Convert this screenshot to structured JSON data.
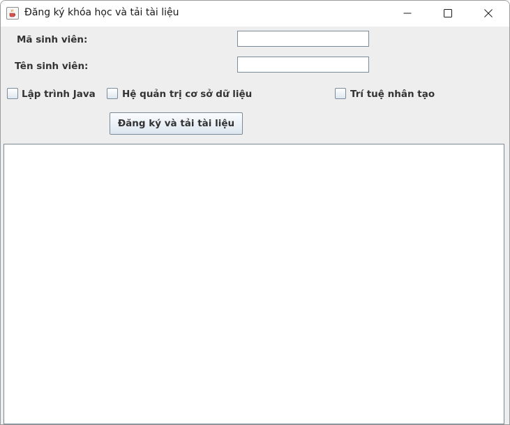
{
  "window": {
    "title": "Đăng ký khóa học và tải tài liệu",
    "icon": "java-cup-icon"
  },
  "form": {
    "student_id_label": "Mã sinh viên:",
    "student_id_value": "",
    "student_name_label": "Tên sinh viên:",
    "student_name_value": ""
  },
  "courses": [
    {
      "label": "Lập trình Java",
      "checked": false
    },
    {
      "label": "Hệ quản trị cơ sở dữ liệu",
      "checked": false
    },
    {
      "label": "Trí tuệ nhân tạo",
      "checked": false
    }
  ],
  "actions": {
    "submit_label": "Đăng ký và tải tài liệu"
  },
  "output": {
    "text": ""
  },
  "colors": {
    "window_bg": "#eeeeee",
    "titlebar_bg": "#ffffff",
    "field_border": "#7a8a99",
    "label_text": "#333333"
  }
}
